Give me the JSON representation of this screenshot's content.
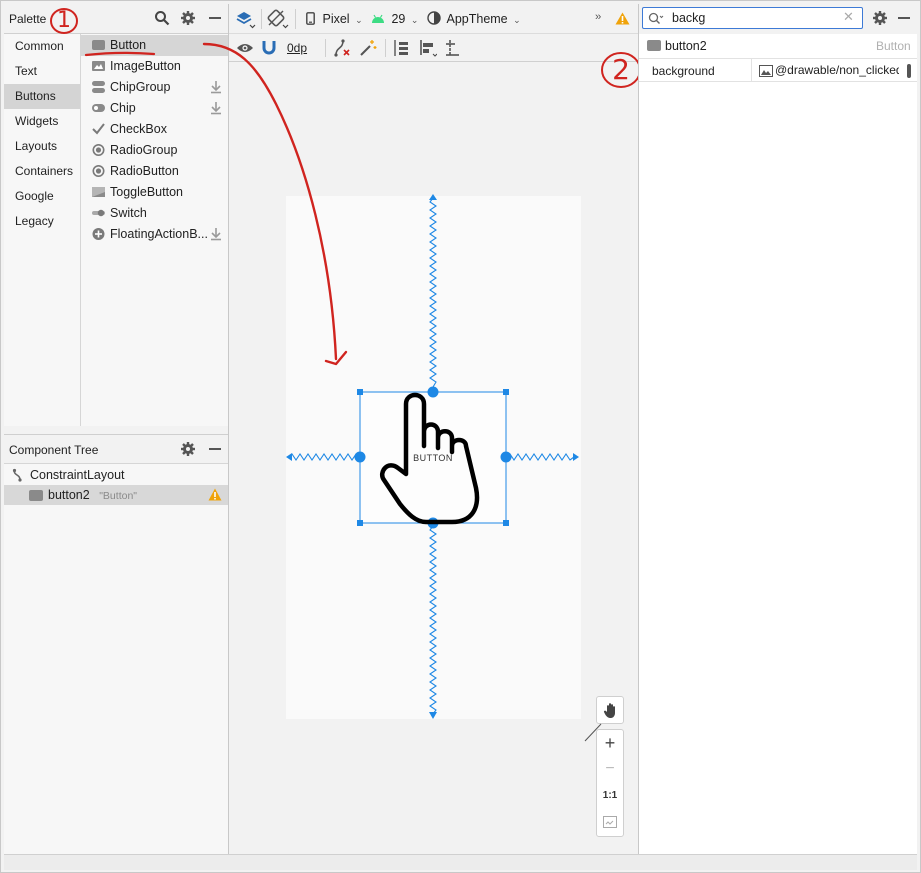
{
  "palette": {
    "title": "Palette",
    "categories": [
      "Common",
      "Text",
      "Buttons",
      "Widgets",
      "Layouts",
      "Containers",
      "Google",
      "Legacy"
    ],
    "selected_category": "Buttons",
    "items": [
      "Button",
      "ImageButton",
      "ChipGroup",
      "Chip",
      "CheckBox",
      "RadioGroup",
      "RadioButton",
      "ToggleButton",
      "Switch",
      "FloatingActionB..."
    ]
  },
  "component_tree": {
    "title": "Component Tree",
    "root": "ConstraintLayout",
    "child_name": "button2",
    "child_text": "\"Button\""
  },
  "toolbar": {
    "device": "Pixel",
    "api": "29",
    "theme": "AppTheme",
    "margin": "0dp"
  },
  "canvas": {
    "button_text": "BUTTON"
  },
  "zoom": {
    "plus": "+",
    "minus": "−",
    "one_to_one": "1:1"
  },
  "attributes": {
    "search_value": "backg",
    "component_id": "button2",
    "component_type": "Button",
    "attr_name": "background",
    "attr_value": "@drawable/non_clicked"
  },
  "annotations": {
    "mark1": "1",
    "mark2": "2"
  },
  "colors": {
    "accent": "#1e88e5",
    "annotation_red": "#d0241f",
    "warning": "#f0a30a"
  }
}
